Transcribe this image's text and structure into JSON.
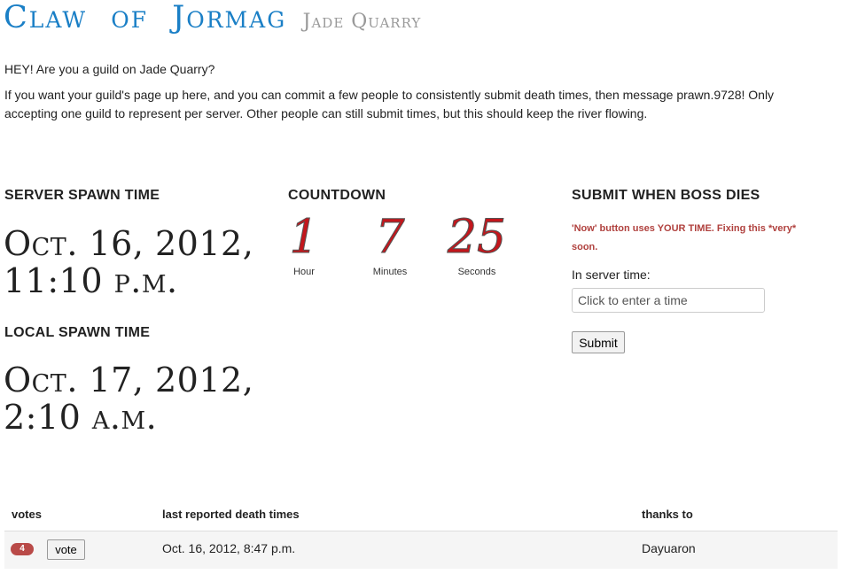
{
  "header": {
    "title": "Claw of Jormag",
    "server": "Jade Quarry"
  },
  "intro": {
    "line1": "HEY! Are you a guild on Jade Quarry?",
    "line2": "If you want your guild's page up here, and you can commit a few people to consistently submit death times, then message prawn.9728! Only accepting one guild to represent per server. Other people can still submit times, but this should keep the river flowing."
  },
  "server_spawn": {
    "heading": "SERVER SPAWN TIME",
    "date_line1": "Oct. 16, 2012,",
    "date_line2": "11:10 p.m."
  },
  "local_spawn": {
    "heading": "LOCAL SPAWN TIME",
    "date_line1": "Oct. 17, 2012,",
    "date_line2": "2:10 a.m."
  },
  "countdown": {
    "heading": "COUNTDOWN",
    "hours": "1",
    "hours_label": "Hour",
    "minutes": "7",
    "minutes_label": "Minutes",
    "seconds": "25",
    "seconds_label": "Seconds",
    "digit_color": "#c3161c"
  },
  "submit": {
    "heading": "SUBMIT WHEN BOSS DIES",
    "warning": "'Now' button uses YOUR TIME. Fixing this *very* soon.",
    "server_time_label": "In server time:",
    "input_placeholder": "Click to enter a time",
    "button_label": "Submit"
  },
  "table": {
    "headers": {
      "votes": "votes",
      "death_times": "last reported death times",
      "thanks": "thanks to"
    },
    "rows": [
      {
        "votes": "4",
        "vote_label": "vote",
        "death_time": "Oct. 16, 2012, 8:47 p.m.",
        "thanks_to": "Dayuaron"
      }
    ]
  },
  "colors": {
    "title_blue": "#1a7fc6",
    "subtitle_gray": "#999999",
    "warning_red": "#b0413e",
    "badge_red": "#b94a48"
  }
}
